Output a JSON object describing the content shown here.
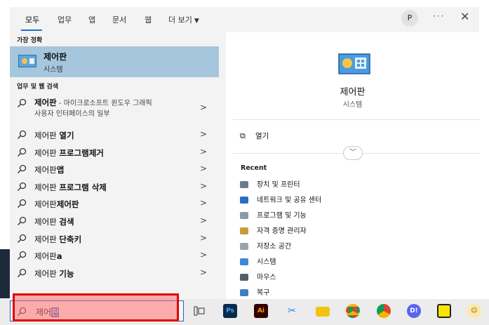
{
  "tabs": {
    "all": "모두",
    "work": "업무",
    "apps": "앱",
    "documents": "문서",
    "web": "웹",
    "more": "더 보기"
  },
  "header": {
    "avatar_letter": "P",
    "more_label": "···",
    "close_label": "✕"
  },
  "best_match": {
    "heading": "가장 정확",
    "title": "제어판",
    "subtitle": "시스템"
  },
  "work_web": {
    "heading": "업무 및 웹 검색",
    "first": {
      "title": "제어판",
      "suffix": " - 마이크로소프트 윈도우 그래픽",
      "line2": "사용자 인터페이스의 일부"
    },
    "items": [
      {
        "base": "제어판 ",
        "bold": "열기"
      },
      {
        "base": "제어판 ",
        "bold": "프로그램제거"
      },
      {
        "base": "제어판",
        "bold": "앱"
      },
      {
        "base": "제어판 ",
        "bold": "프로그램 삭제"
      },
      {
        "base": "제어판",
        "bold": "제어판"
      },
      {
        "base": "제어판 ",
        "bold": "검색"
      },
      {
        "base": "제어판 ",
        "bold": "단축키"
      },
      {
        "base": "제어판",
        "bold": "a"
      },
      {
        "base": "제어판 ",
        "bold": "기능"
      }
    ]
  },
  "preview": {
    "title": "제어판",
    "subtitle": "시스템",
    "open_label": "열기",
    "recent_heading": "Recent",
    "recent": [
      {
        "label": "장치 및 프린터",
        "color": "#6b7b8c"
      },
      {
        "label": "네트워크 및 공유 센터",
        "color": "#2b6cc4"
      },
      {
        "label": "프로그램 및 기능",
        "color": "#8a9aa8"
      },
      {
        "label": "자격 증명 관리자",
        "color": "#c89b3c"
      },
      {
        "label": "저장소 공간",
        "color": "#9aa3ab"
      },
      {
        "label": "시스템",
        "color": "#3a8ad6"
      },
      {
        "label": "마우스",
        "color": "#555f69"
      },
      {
        "label": "복구",
        "color": "#3f7fc4"
      }
    ]
  },
  "taskbar": {
    "search_typed": "제어",
    "search_selected": "판",
    "ps_label": "Ps",
    "ai_label": "Ai",
    "di_label": "D!"
  }
}
